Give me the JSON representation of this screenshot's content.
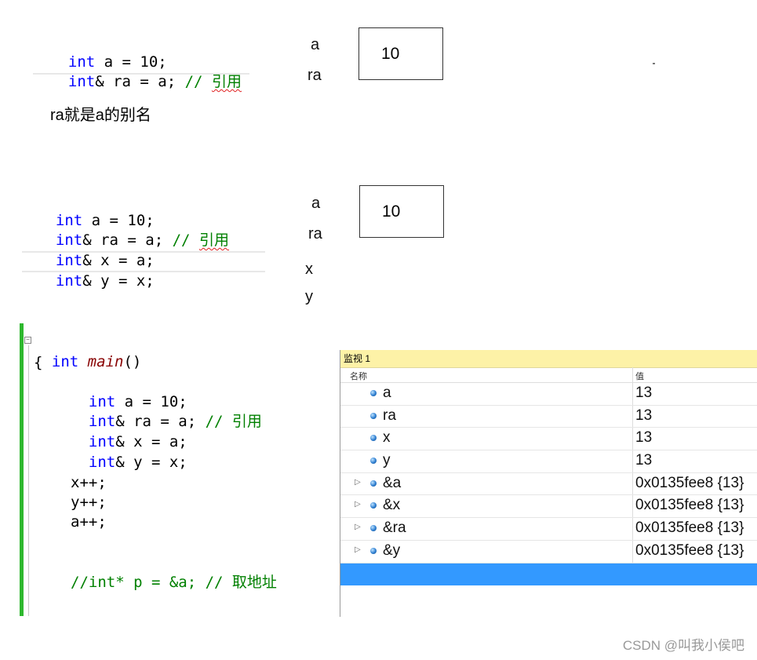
{
  "snippet1": {
    "line1": {
      "kw": "int",
      "rest": " a = 10;"
    },
    "line2": {
      "kw": "int",
      "rest": "& ra = a; ",
      "comment": "// ",
      "comment_cn": "引用"
    }
  },
  "diagram1": {
    "labels": [
      "a",
      "ra"
    ],
    "box_value": "10"
  },
  "note": "ra就是a的别名",
  "snippet2": {
    "line1": {
      "kw": "int",
      "rest": " a = 10;"
    },
    "line2": {
      "kw": "int",
      "rest": "& ra = a; ",
      "comment": "// ",
      "comment_cn": "引用"
    },
    "line3": {
      "kw": "int",
      "rest": "& x = a;"
    },
    "line4": {
      "kw": "int",
      "rest": "& y = x;"
    }
  },
  "diagram2": {
    "labels": [
      "a",
      "ra",
      "x",
      "y"
    ],
    "box_value": "10"
  },
  "snippet3": {
    "main_kw": "int",
    "main_fn": "main",
    "main_paren": "()",
    "open_brace": "{",
    "l1": {
      "kw": "int",
      "rest": " a = 10;"
    },
    "l2": {
      "kw": "int",
      "rest": "& ra = a; ",
      "comment": "// 引用"
    },
    "l3": {
      "kw": "int",
      "rest": "& x = a;"
    },
    "l4": {
      "kw": "int",
      "rest": "& y = x;"
    },
    "l5": "x++;",
    "l6": "y++;",
    "l7": "a++;",
    "l8_comment": "//int* p = &a; // 取地址"
  },
  "watch": {
    "title": "监视 1",
    "col_name": "名称",
    "col_value": "值",
    "rows": [
      {
        "name": "a",
        "value": "13",
        "expandable": false
      },
      {
        "name": "ra",
        "value": "13",
        "expandable": false
      },
      {
        "name": "x",
        "value": "13",
        "expandable": false
      },
      {
        "name": "y",
        "value": "13",
        "expandable": false
      },
      {
        "name": "&a",
        "value": "0x0135fee8 {13}",
        "expandable": true
      },
      {
        "name": "&x",
        "value": "0x0135fee8 {13}",
        "expandable": true
      },
      {
        "name": "&ra",
        "value": "0x0135fee8 {13}",
        "expandable": true
      },
      {
        "name": "&y",
        "value": "0x0135fee8 {13}",
        "expandable": true
      }
    ]
  },
  "watermark": "CSDN @叫我小侯吧",
  "colors": {
    "keyword": "#0000ff",
    "comment": "#008000",
    "function": "#880000",
    "selection": "#3399ff",
    "watch_title_bg": "#fdf2a7",
    "margin_bar": "#2eb82e"
  }
}
